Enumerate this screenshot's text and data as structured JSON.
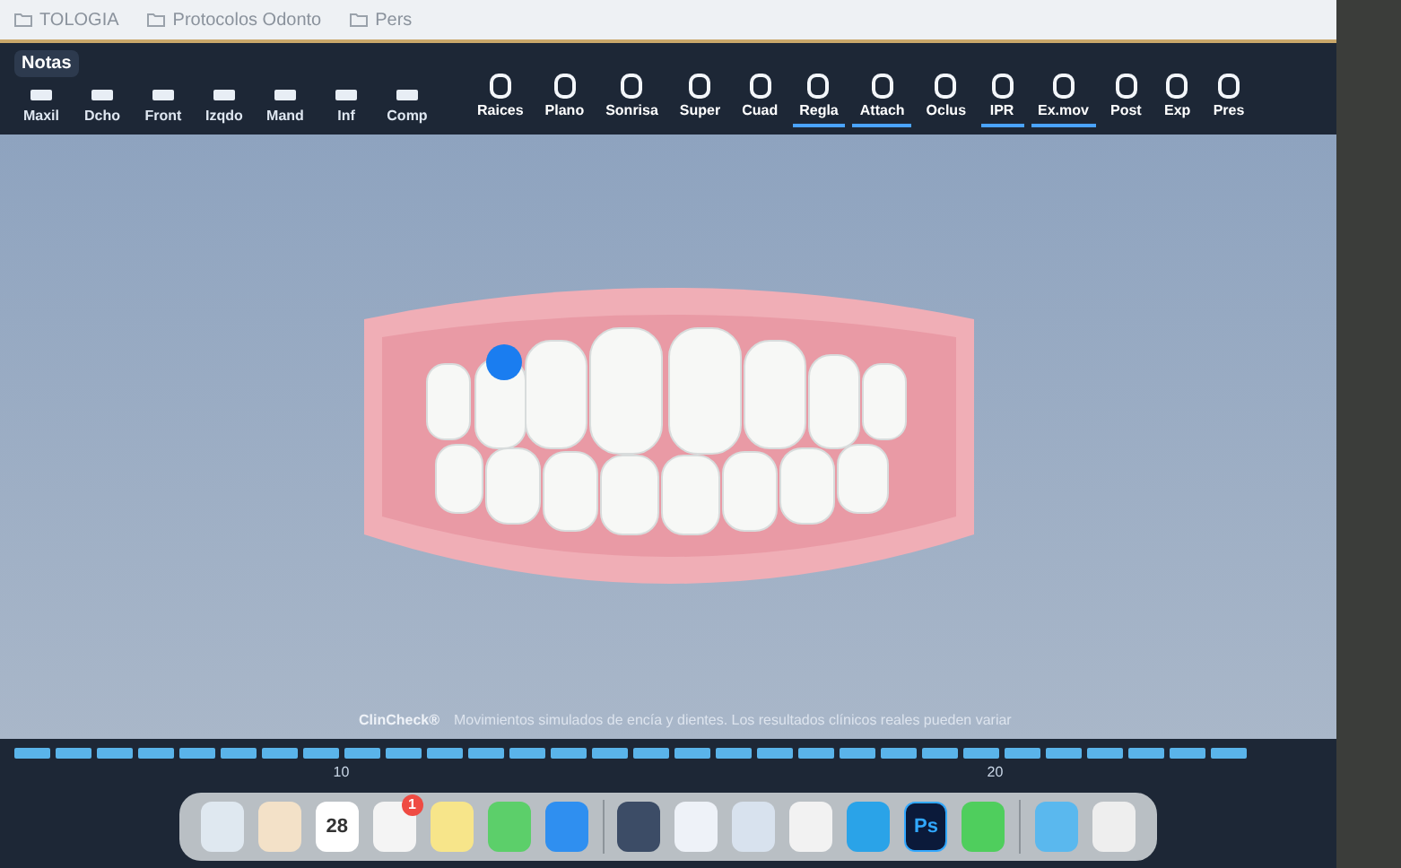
{
  "bookmarks": [
    {
      "label": "TOLOGIA"
    },
    {
      "label": "Protocolos Odonto"
    },
    {
      "label": "Pers"
    }
  ],
  "notes_tab": {
    "label": "Notas"
  },
  "view_buttons": [
    {
      "label": "Maxil"
    },
    {
      "label": "Dcho"
    },
    {
      "label": "Front"
    },
    {
      "label": "Izqdo"
    },
    {
      "label": "Mand"
    },
    {
      "label": "Inf"
    },
    {
      "label": "Comp"
    }
  ],
  "tools": [
    {
      "label": "Raices",
      "selected": false
    },
    {
      "label": "Plano",
      "selected": false
    },
    {
      "label": "Sonrisa",
      "selected": false
    },
    {
      "label": "Super",
      "selected": false
    },
    {
      "label": "Cuad",
      "selected": false
    },
    {
      "label": "Regla",
      "selected": true
    },
    {
      "label": "Attach",
      "selected": true
    },
    {
      "label": "Oclus",
      "selected": false
    },
    {
      "label": "IPR",
      "selected": true
    },
    {
      "label": "Ex.mov",
      "selected": true
    },
    {
      "label": "Post",
      "selected": false
    },
    {
      "label": "Exp",
      "selected": false
    },
    {
      "label": "Pres",
      "selected": false
    }
  ],
  "caption": {
    "brand": "ClinCheck®",
    "text": "Movimientos simulados de encía y dientes. Los resultados clínicos reales pueden variar"
  },
  "timeline": {
    "labels": [
      "10",
      "20"
    ]
  },
  "dock": [
    {
      "kind": "plain",
      "color": "#dfe8f0"
    },
    {
      "kind": "plain",
      "color": "#f3e1c8"
    },
    {
      "kind": "calendar",
      "color": "#ffffff",
      "text": "28"
    },
    {
      "kind": "badge",
      "color": "#f4f4f4",
      "text": "1"
    },
    {
      "kind": "plain",
      "color": "#f7e58a"
    },
    {
      "kind": "plain",
      "color": "#5ccf6a"
    },
    {
      "kind": "plain",
      "color": "#2f8ff0"
    },
    {
      "kind": "divider"
    },
    {
      "kind": "plain",
      "color": "#3c4c66"
    },
    {
      "kind": "plain",
      "color": "#eef2f8"
    },
    {
      "kind": "plain",
      "color": "#d8e2ee"
    },
    {
      "kind": "plain",
      "color": "#f2f2f2"
    },
    {
      "kind": "plain",
      "color": "#2aa3e8"
    },
    {
      "kind": "text",
      "color": "#0b1a3a",
      "text": "Ps"
    },
    {
      "kind": "plain",
      "color": "#4fce5d"
    },
    {
      "kind": "divider"
    },
    {
      "kind": "plain",
      "color": "#5ab8ee"
    },
    {
      "kind": "plain",
      "color": "#eeeeee"
    }
  ]
}
